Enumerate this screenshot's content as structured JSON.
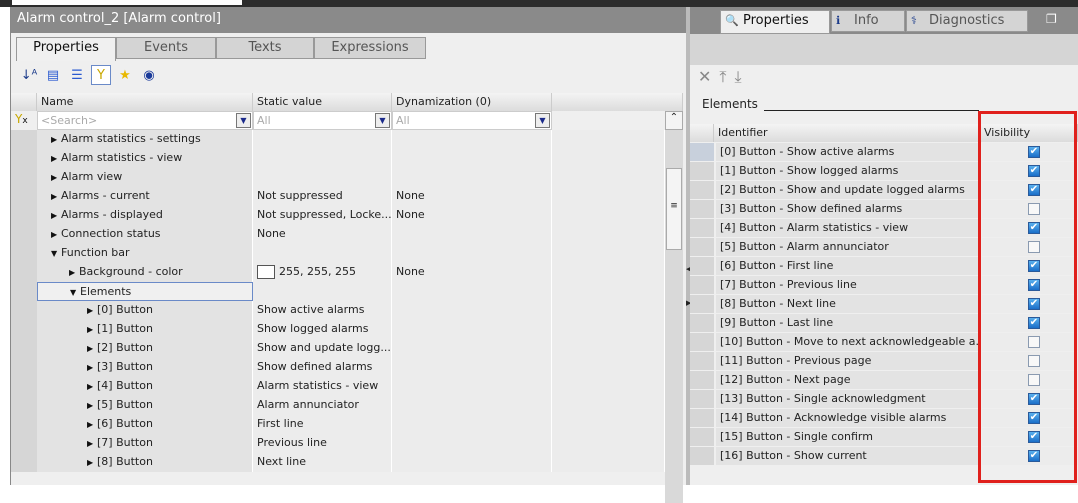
{
  "left": {
    "title": "Alarm control_2 [Alarm control]",
    "tabs": [
      "Properties",
      "Events",
      "Texts",
      "Expressions"
    ],
    "toolbar_icons": [
      "sort-az-icon",
      "collapse-icon",
      "expand-icon",
      "filter-icon",
      "favorite-star-icon",
      "eye-icon"
    ],
    "columns": {
      "name": "Name",
      "static": "Static value",
      "dyn": "Dynamization (0)"
    },
    "search": {
      "placeholder": "<Search>",
      "static_filter": "All",
      "dyn_filter": "All"
    },
    "rows": [
      {
        "indent": 1,
        "exp": "r",
        "name": "Alarm statistics - settings",
        "static": "",
        "dyn": ""
      },
      {
        "indent": 1,
        "exp": "r",
        "name": "Alarm statistics - view",
        "static": "",
        "dyn": ""
      },
      {
        "indent": 1,
        "exp": "r",
        "name": "Alarm view",
        "static": "",
        "dyn": ""
      },
      {
        "indent": 1,
        "exp": "r",
        "name": "Alarms - current",
        "static": "Not suppressed",
        "dyn": "None"
      },
      {
        "indent": 1,
        "exp": "r",
        "name": "Alarms - displayed",
        "static": "Not suppressed, Locke...",
        "dyn": "None"
      },
      {
        "indent": 1,
        "exp": "r",
        "name": "Connection status",
        "static": "None",
        "dyn": ""
      },
      {
        "indent": 1,
        "exp": "d",
        "name": "Function bar",
        "static": "",
        "dyn": ""
      },
      {
        "indent": 2,
        "exp": "r",
        "name": "Background - color",
        "static": "255, 255, 255",
        "dyn": "None",
        "swatch": "#ffffff"
      },
      {
        "indent": 2,
        "exp": "d",
        "name": "Elements",
        "static": "",
        "dyn": "",
        "selected": true
      },
      {
        "indent": 3,
        "exp": "r",
        "name": "[0] Button",
        "static": "Show active alarms",
        "dyn": ""
      },
      {
        "indent": 3,
        "exp": "r",
        "name": "[1] Button",
        "static": "Show logged alarms",
        "dyn": ""
      },
      {
        "indent": 3,
        "exp": "r",
        "name": "[2] Button",
        "static": "Show and update logg...",
        "dyn": ""
      },
      {
        "indent": 3,
        "exp": "r",
        "name": "[3] Button",
        "static": "Show defined alarms",
        "dyn": ""
      },
      {
        "indent": 3,
        "exp": "r",
        "name": "[4] Button",
        "static": "Alarm statistics - view",
        "dyn": ""
      },
      {
        "indent": 3,
        "exp": "r",
        "name": "[5] Button",
        "static": "Alarm annunciator",
        "dyn": ""
      },
      {
        "indent": 3,
        "exp": "r",
        "name": "[6] Button",
        "static": "First line",
        "dyn": ""
      },
      {
        "indent": 3,
        "exp": "r",
        "name": "[7] Button",
        "static": "Previous line",
        "dyn": ""
      },
      {
        "indent": 3,
        "exp": "r",
        "name": "[8] Button",
        "static": "Next line",
        "dyn": ""
      }
    ]
  },
  "right": {
    "tabs": [
      "Properties",
      "Info",
      "Diagnostics"
    ],
    "section": "Elements",
    "columns": {
      "id": "Identifier",
      "vis": "Visibility"
    },
    "rows": [
      {
        "id": "[0] Button - Show active alarms",
        "visible": true
      },
      {
        "id": "[1] Button - Show logged alarms",
        "visible": true
      },
      {
        "id": "[2] Button - Show and update logged alarms",
        "visible": true
      },
      {
        "id": "[3] Button - Show defined alarms",
        "visible": false
      },
      {
        "id": "[4] Button - Alarm statistics - view",
        "visible": true
      },
      {
        "id": "[5] Button - Alarm annunciator",
        "visible": false
      },
      {
        "id": "[6] Button - First line",
        "visible": true
      },
      {
        "id": "[7] Button - Previous line",
        "visible": true
      },
      {
        "id": "[8] Button - Next line",
        "visible": true
      },
      {
        "id": "[9] Button - Last line",
        "visible": true
      },
      {
        "id": "[10] Button - Move to next acknowledgeable a...",
        "visible": false
      },
      {
        "id": "[11] Button - Previous page",
        "visible": false
      },
      {
        "id": "[12] Button - Next page",
        "visible": false
      },
      {
        "id": "[13] Button - Single acknowledgment",
        "visible": true
      },
      {
        "id": "[14] Button - Acknowledge visible alarms",
        "visible": true
      },
      {
        "id": "[15] Button - Single confirm",
        "visible": true
      },
      {
        "id": "[16] Button - Show current",
        "visible": true
      }
    ],
    "highlight_color": "#e0201c"
  }
}
